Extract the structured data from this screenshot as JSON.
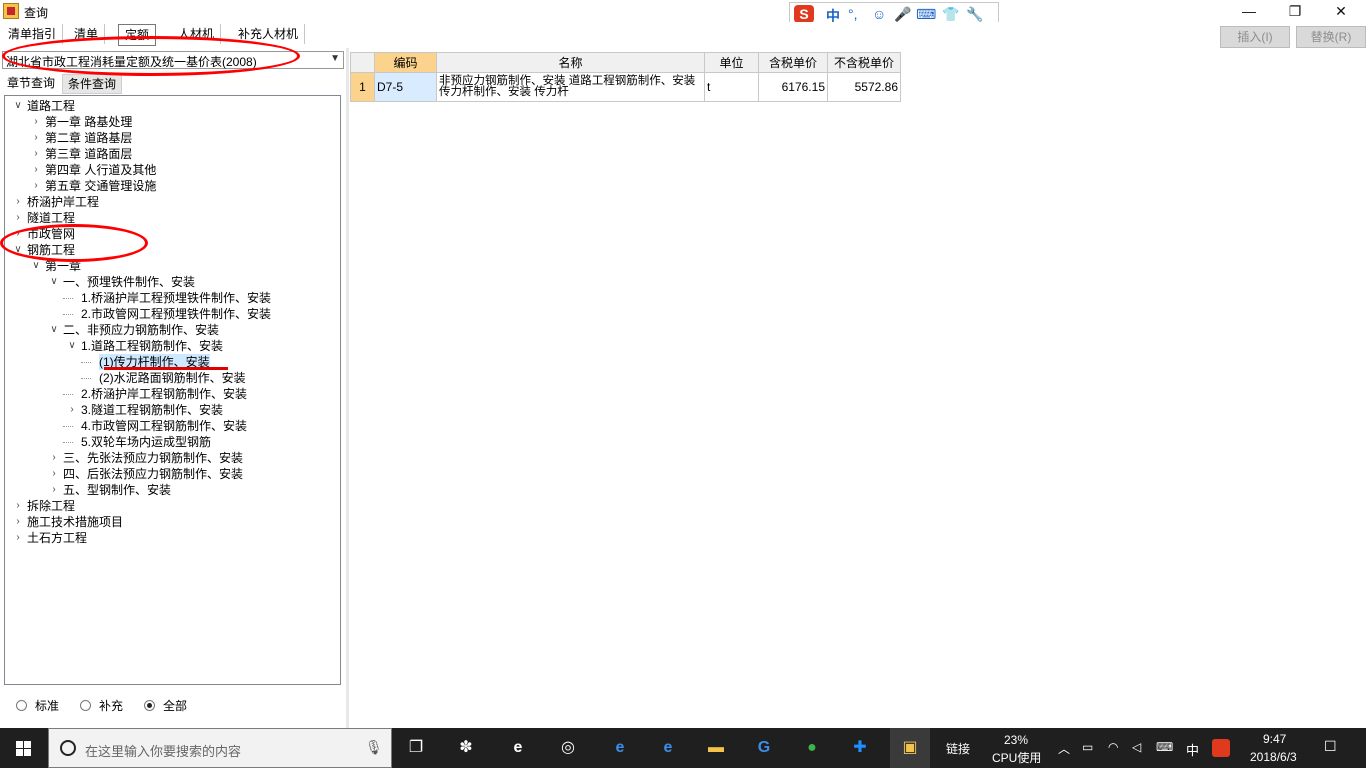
{
  "window": {
    "title": "查询",
    "minimize": "—",
    "restore": "❐",
    "close": "✕"
  },
  "ime": {
    "logo": "S",
    "mode": "中",
    "punct": "°,",
    "glyphs": [
      "☺",
      "🎤",
      "⌨",
      "👕",
      "🔧"
    ]
  },
  "tabs": [
    "清单指引",
    "清单",
    "定额",
    "人材机",
    "补充人材机"
  ],
  "toolbar": {
    "insert": "插入(I)",
    "replace": "替换(R)"
  },
  "combo": {
    "value": "湖北省市政工程消耗量定额及统一基价表(2008)"
  },
  "subtabs": [
    "章节查询",
    "条件查询"
  ],
  "tree": [
    {
      "label": "道路工程",
      "level": 0,
      "state": "open"
    },
    {
      "label": "第一章  路基处理",
      "level": 1,
      "state": "closed"
    },
    {
      "label": "第二章    道路基层",
      "level": 1,
      "state": "closed"
    },
    {
      "label": "第三章  道路面层",
      "level": 1,
      "state": "closed"
    },
    {
      "label": "第四章  人行道及其他",
      "level": 1,
      "state": "closed"
    },
    {
      "label": "第五章  交通管理设施",
      "level": 1,
      "state": "closed"
    },
    {
      "label": "桥涵护岸工程",
      "level": 0,
      "state": "closed"
    },
    {
      "label": "隧道工程",
      "level": 0,
      "state": "closed"
    },
    {
      "label": "市政管网",
      "level": 0,
      "state": "closed"
    },
    {
      "label": "钢筋工程",
      "level": 0,
      "state": "open"
    },
    {
      "label": "第一章",
      "level": 1,
      "state": "open"
    },
    {
      "label": "一、预埋铁件制作、安装",
      "level": 2,
      "state": "open"
    },
    {
      "label": "1.桥涵护岸工程预埋铁件制作、安装",
      "level": 3,
      "state": "leaf"
    },
    {
      "label": "2.市政管网工程预埋铁件制作、安装",
      "level": 3,
      "state": "leaf"
    },
    {
      "label": "二、非预应力钢筋制作、安装",
      "level": 2,
      "state": "open"
    },
    {
      "label": "1.道路工程钢筋制作、安装",
      "level": 3,
      "state": "open"
    },
    {
      "label": "(1)传力杆制作、安装",
      "level": 4,
      "state": "leaf",
      "selected": true
    },
    {
      "label": "(2)水泥路面钢筋制作、安装",
      "level": 4,
      "state": "leaf"
    },
    {
      "label": "2.桥涵护岸工程钢筋制作、安装",
      "level": 3,
      "state": "leaf"
    },
    {
      "label": "3.隧道工程钢筋制作、安装",
      "level": 3,
      "state": "closed"
    },
    {
      "label": "4.市政管网工程钢筋制作、安装",
      "level": 3,
      "state": "leaf"
    },
    {
      "label": "5.双轮车场内运成型钢筋",
      "level": 3,
      "state": "leaf"
    },
    {
      "label": "三、先张法预应力钢筋制作、安装",
      "level": 2,
      "state": "closed"
    },
    {
      "label": "四、后张法预应力钢筋制作、安装",
      "level": 2,
      "state": "closed"
    },
    {
      "label": "五、型钢制作、安装",
      "level": 2,
      "state": "closed"
    },
    {
      "label": "拆除工程",
      "level": 0,
      "state": "closed"
    },
    {
      "label": "施工技术措施项目",
      "level": 0,
      "state": "closed"
    },
    {
      "label": "土石方工程",
      "level": 0,
      "state": "closed"
    }
  ],
  "radios": [
    {
      "label": "标准",
      "checked": false
    },
    {
      "label": "补充",
      "checked": false
    },
    {
      "label": "全部",
      "checked": true
    }
  ],
  "grid": {
    "headers": [
      "编码",
      "名称",
      "单位",
      "含税单价",
      "不含税单价"
    ],
    "rows": [
      {
        "no": "1",
        "code": "D7-5",
        "name": "非预应力钢筋制作、安装 道路工程钢筋制作、安装 传力杆制作、安装 传力杆",
        "unit": "t",
        "price_tax": "6176.15",
        "price_notax": "5572.86"
      }
    ]
  },
  "taskbar": {
    "search_placeholder": "在这里输入你要搜索的内容",
    "link": "链接",
    "cpu_percent": "23%",
    "cpu_label": "CPU使用",
    "ime": "中",
    "time": "9:47",
    "date": "2018/6/3"
  },
  "colors": {
    "accent_red": "#ff0000",
    "grid_header_selected": "#fbd38c",
    "selection": "#cde8ff"
  }
}
